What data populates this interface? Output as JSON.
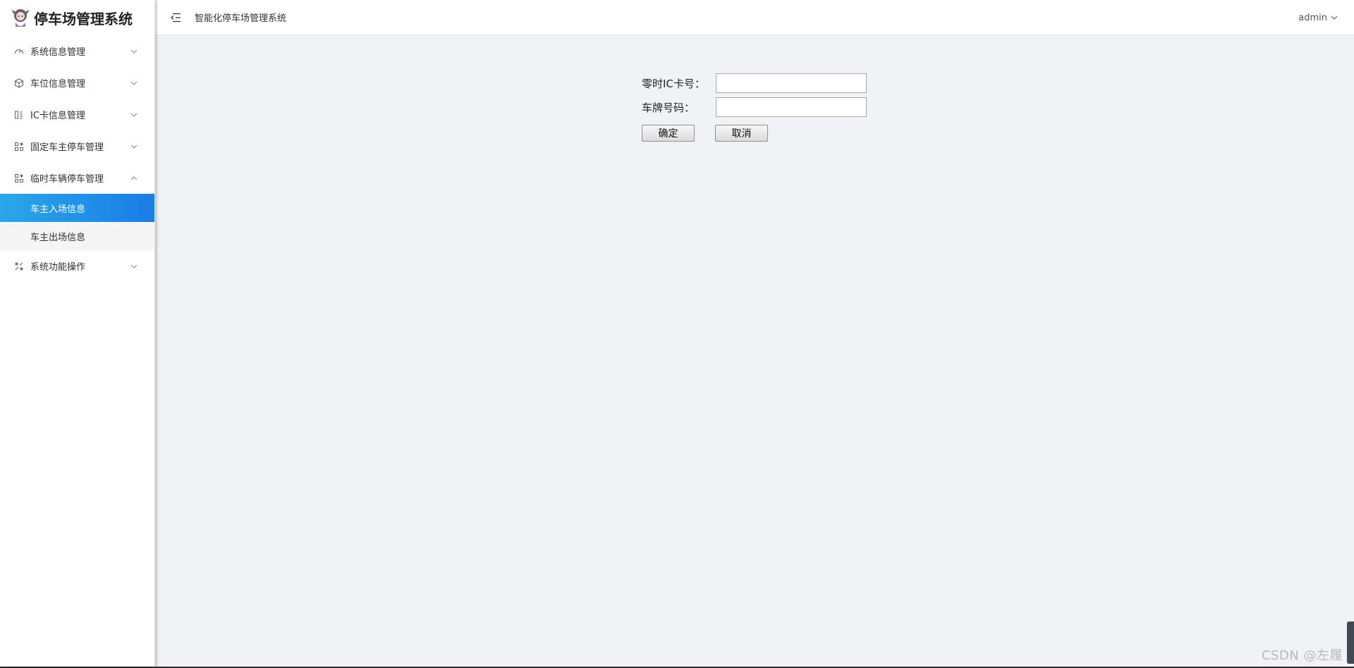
{
  "sidebar": {
    "logo_text": "停车场管理系统",
    "menu": [
      {
        "label": "系统信息管理",
        "icon": "dashboard-icon",
        "expanded": false
      },
      {
        "label": "车位信息管理",
        "icon": "box-icon",
        "expanded": false
      },
      {
        "label": "IC卡信息管理",
        "icon": "card-icon",
        "expanded": false
      },
      {
        "label": "固定车主停车管理",
        "icon": "grid-icon",
        "expanded": false
      },
      {
        "label": "临时车辆停车管理",
        "icon": "grid-icon",
        "expanded": true,
        "children": [
          {
            "label": "车主入场信息",
            "active": true
          },
          {
            "label": "车主出场信息",
            "active": false
          }
        ]
      },
      {
        "label": "系统功能操作",
        "icon": "tools-icon",
        "expanded": false
      }
    ]
  },
  "header": {
    "title": "智能化停车场管理系统",
    "user": "admin"
  },
  "form": {
    "ic_label": "零时IC卡号：",
    "ic_value": "",
    "plate_label": "车牌号码：",
    "plate_value": "",
    "confirm_label": "确定",
    "cancel_label": "取消"
  },
  "watermark": "CSDN @左履",
  "colors": {
    "active_start": "#2aa6ea",
    "active_end": "#1a7de6",
    "content_bg": "#f0f2f5"
  }
}
